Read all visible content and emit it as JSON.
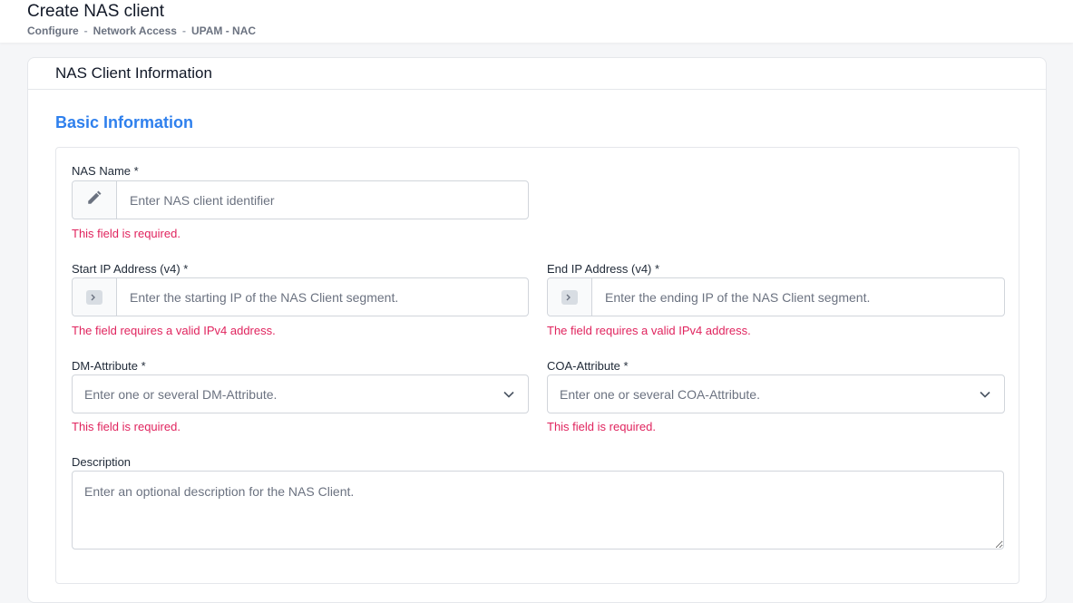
{
  "header": {
    "title": "Create NAS client",
    "breadcrumb": [
      "Configure",
      "Network Access",
      "UPAM - NAC"
    ]
  },
  "card": {
    "title": "NAS Client Information",
    "section_title": "Basic Information"
  },
  "fields": {
    "nas_name": {
      "label": "NAS Name *",
      "placeholder": "Enter NAS client identifier",
      "value": "",
      "error": "This field is required.",
      "icon": "pencil-icon"
    },
    "start_ip": {
      "label": "Start IP Address (v4) *",
      "placeholder": "Enter the starting IP of the NAS Client segment.",
      "value": "",
      "error": "The field requires a valid IPv4 address.",
      "icon": "terminal-icon"
    },
    "end_ip": {
      "label": "End IP Address (v4) *",
      "placeholder": "Enter the ending IP of the NAS Client segment.",
      "value": "",
      "error": "The field requires a valid IPv4 address.",
      "icon": "terminal-icon"
    },
    "dm_attribute": {
      "label": "DM-Attribute *",
      "placeholder": "Enter one or several DM-Attribute.",
      "error": "This field is required."
    },
    "coa_attribute": {
      "label": "COA-Attribute *",
      "placeholder": "Enter one or several COA-Attribute.",
      "error": "This field is required."
    },
    "description": {
      "label": "Description",
      "placeholder": "Enter an optional description for the NAS Client.",
      "value": ""
    }
  },
  "colors": {
    "accent": "#2f80ed",
    "error": "#e0245e",
    "border": "#d1d5db"
  }
}
